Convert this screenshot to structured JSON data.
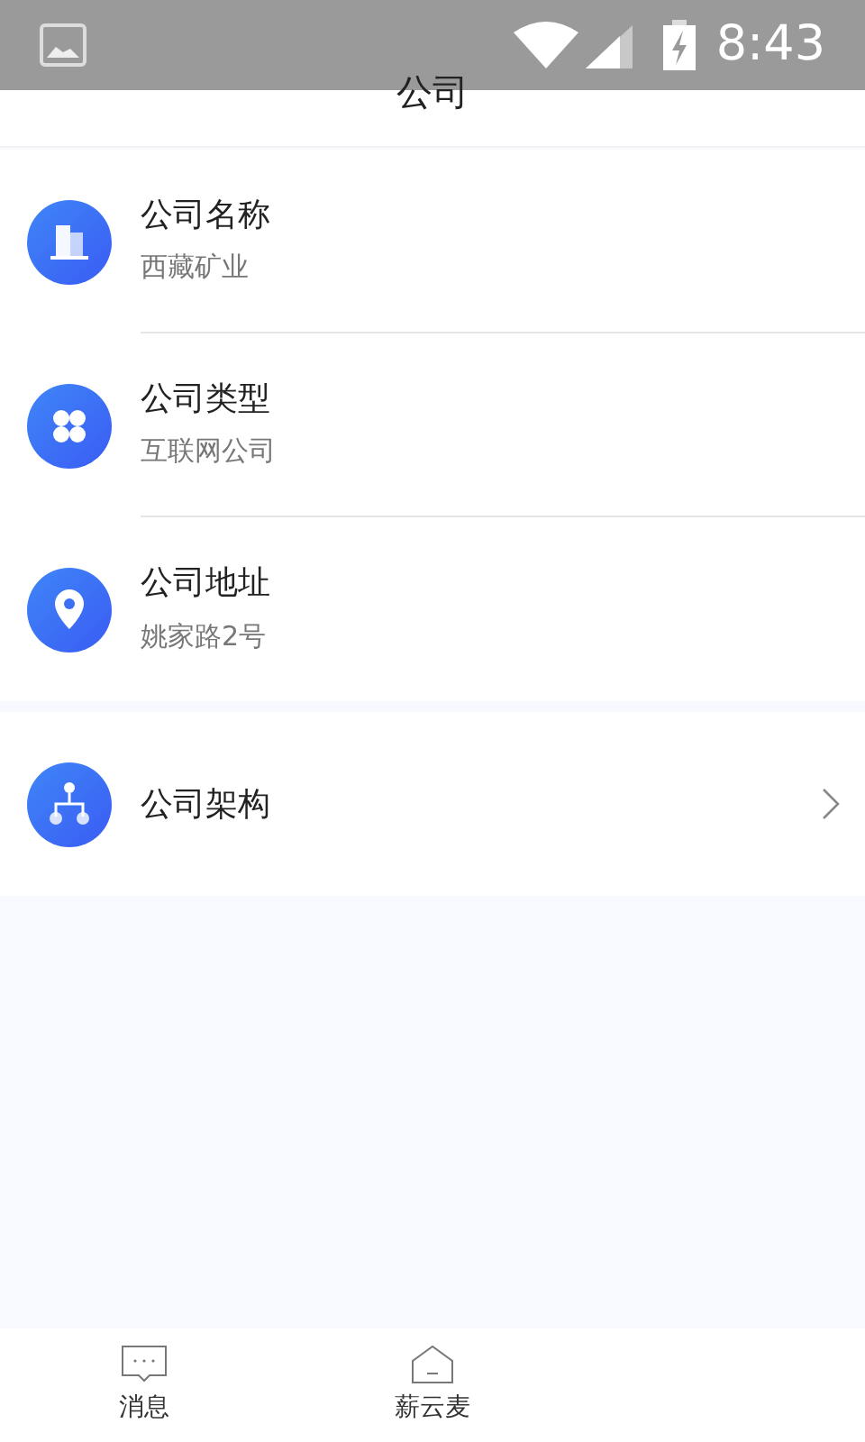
{
  "status_bar": {
    "time": "8:43"
  },
  "header": {
    "title": "公司"
  },
  "info_items": [
    {
      "kind": "building",
      "label": "公司名称",
      "value": "西藏矿业"
    },
    {
      "kind": "category",
      "label": "公司类型",
      "value": "互联网公司"
    },
    {
      "kind": "location",
      "label": "公司地址",
      "value": "姚家路2号"
    }
  ],
  "structure_item": {
    "kind": "org",
    "label": "公司架构"
  },
  "tab_bar": [
    {
      "kind": "chat",
      "label": "消息"
    },
    {
      "kind": "home",
      "label": "薪云麦"
    }
  ]
}
